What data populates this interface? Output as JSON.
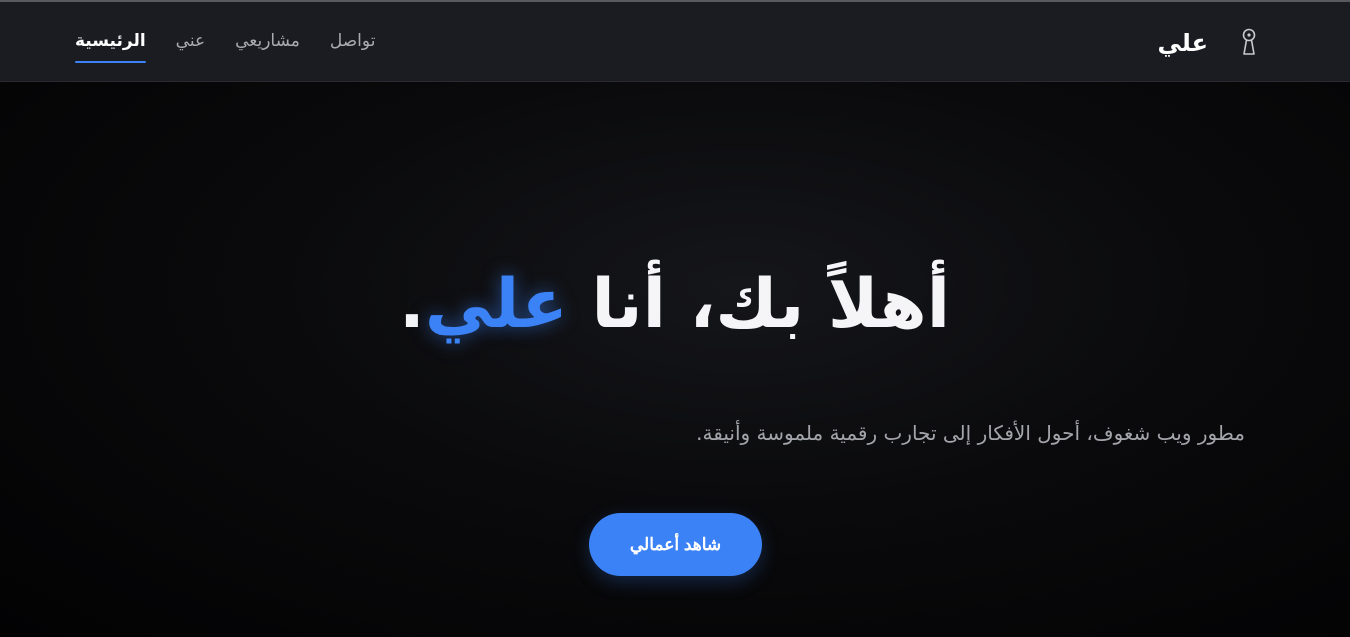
{
  "header": {
    "brand_name": "علي",
    "brand_icon": "keyhole-icon",
    "nav": [
      {
        "label": "الرئيسية",
        "active": true
      },
      {
        "label": "عني",
        "active": false
      },
      {
        "label": "مشاريعي",
        "active": false
      },
      {
        "label": "تواصل",
        "active": false
      }
    ]
  },
  "hero": {
    "title_prefix": "أهلاً بك، أنا ",
    "title_name": "علي",
    "title_suffix": ".",
    "subtitle": "مطور ويب شغوف، أحول الأفكار إلى تجارب رقمية ملموسة وأنيقة.",
    "cta_label": "شاهد أعمالي"
  },
  "colors": {
    "accent": "#3b82f6",
    "navbar_bg": "#1b1c21",
    "page_bg": "#000000",
    "text_primary": "#ffffff",
    "text_muted": "#a9abb2"
  }
}
